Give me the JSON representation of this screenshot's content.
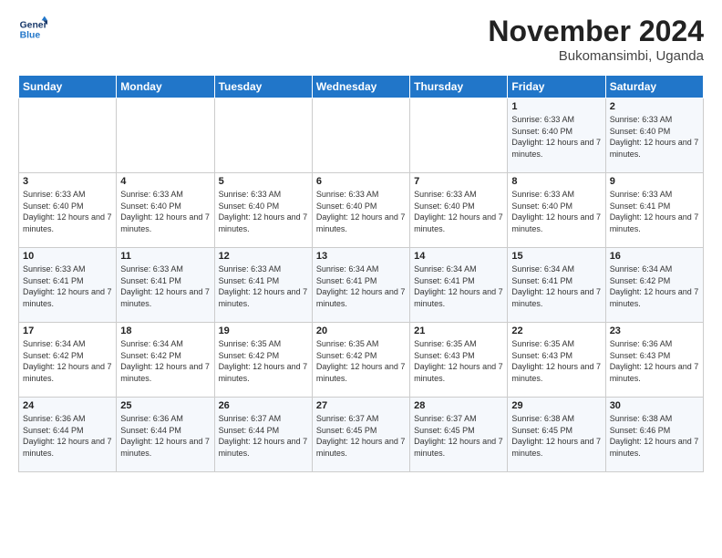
{
  "logo": {
    "line1": "General",
    "line2": "Blue"
  },
  "title": "November 2024",
  "location": "Bukomansimbi, Uganda",
  "days_of_week": [
    "Sunday",
    "Monday",
    "Tuesday",
    "Wednesday",
    "Thursday",
    "Friday",
    "Saturday"
  ],
  "weeks": [
    [
      {
        "day": "",
        "empty": true
      },
      {
        "day": "",
        "empty": true
      },
      {
        "day": "",
        "empty": true
      },
      {
        "day": "",
        "empty": true
      },
      {
        "day": "",
        "empty": true
      },
      {
        "day": "1",
        "sunrise": "6:33 AM",
        "sunset": "6:40 PM",
        "daylight": "12 hours and 7 minutes."
      },
      {
        "day": "2",
        "sunrise": "6:33 AM",
        "sunset": "6:40 PM",
        "daylight": "12 hours and 7 minutes."
      }
    ],
    [
      {
        "day": "3",
        "sunrise": "6:33 AM",
        "sunset": "6:40 PM",
        "daylight": "12 hours and 7 minutes."
      },
      {
        "day": "4",
        "sunrise": "6:33 AM",
        "sunset": "6:40 PM",
        "daylight": "12 hours and 7 minutes."
      },
      {
        "day": "5",
        "sunrise": "6:33 AM",
        "sunset": "6:40 PM",
        "daylight": "12 hours and 7 minutes."
      },
      {
        "day": "6",
        "sunrise": "6:33 AM",
        "sunset": "6:40 PM",
        "daylight": "12 hours and 7 minutes."
      },
      {
        "day": "7",
        "sunrise": "6:33 AM",
        "sunset": "6:40 PM",
        "daylight": "12 hours and 7 minutes."
      },
      {
        "day": "8",
        "sunrise": "6:33 AM",
        "sunset": "6:40 PM",
        "daylight": "12 hours and 7 minutes."
      },
      {
        "day": "9",
        "sunrise": "6:33 AM",
        "sunset": "6:41 PM",
        "daylight": "12 hours and 7 minutes."
      }
    ],
    [
      {
        "day": "10",
        "sunrise": "6:33 AM",
        "sunset": "6:41 PM",
        "daylight": "12 hours and 7 minutes."
      },
      {
        "day": "11",
        "sunrise": "6:33 AM",
        "sunset": "6:41 PM",
        "daylight": "12 hours and 7 minutes."
      },
      {
        "day": "12",
        "sunrise": "6:33 AM",
        "sunset": "6:41 PM",
        "daylight": "12 hours and 7 minutes."
      },
      {
        "day": "13",
        "sunrise": "6:34 AM",
        "sunset": "6:41 PM",
        "daylight": "12 hours and 7 minutes."
      },
      {
        "day": "14",
        "sunrise": "6:34 AM",
        "sunset": "6:41 PM",
        "daylight": "12 hours and 7 minutes."
      },
      {
        "day": "15",
        "sunrise": "6:34 AM",
        "sunset": "6:41 PM",
        "daylight": "12 hours and 7 minutes."
      },
      {
        "day": "16",
        "sunrise": "6:34 AM",
        "sunset": "6:42 PM",
        "daylight": "12 hours and 7 minutes."
      }
    ],
    [
      {
        "day": "17",
        "sunrise": "6:34 AM",
        "sunset": "6:42 PM",
        "daylight": "12 hours and 7 minutes."
      },
      {
        "day": "18",
        "sunrise": "6:34 AM",
        "sunset": "6:42 PM",
        "daylight": "12 hours and 7 minutes."
      },
      {
        "day": "19",
        "sunrise": "6:35 AM",
        "sunset": "6:42 PM",
        "daylight": "12 hours and 7 minutes."
      },
      {
        "day": "20",
        "sunrise": "6:35 AM",
        "sunset": "6:42 PM",
        "daylight": "12 hours and 7 minutes."
      },
      {
        "day": "21",
        "sunrise": "6:35 AM",
        "sunset": "6:43 PM",
        "daylight": "12 hours and 7 minutes."
      },
      {
        "day": "22",
        "sunrise": "6:35 AM",
        "sunset": "6:43 PM",
        "daylight": "12 hours and 7 minutes."
      },
      {
        "day": "23",
        "sunrise": "6:36 AM",
        "sunset": "6:43 PM",
        "daylight": "12 hours and 7 minutes."
      }
    ],
    [
      {
        "day": "24",
        "sunrise": "6:36 AM",
        "sunset": "6:44 PM",
        "daylight": "12 hours and 7 minutes."
      },
      {
        "day": "25",
        "sunrise": "6:36 AM",
        "sunset": "6:44 PM",
        "daylight": "12 hours and 7 minutes."
      },
      {
        "day": "26",
        "sunrise": "6:37 AM",
        "sunset": "6:44 PM",
        "daylight": "12 hours and 7 minutes."
      },
      {
        "day": "27",
        "sunrise": "6:37 AM",
        "sunset": "6:45 PM",
        "daylight": "12 hours and 7 minutes."
      },
      {
        "day": "28",
        "sunrise": "6:37 AM",
        "sunset": "6:45 PM",
        "daylight": "12 hours and 7 minutes."
      },
      {
        "day": "29",
        "sunrise": "6:38 AM",
        "sunset": "6:45 PM",
        "daylight": "12 hours and 7 minutes."
      },
      {
        "day": "30",
        "sunrise": "6:38 AM",
        "sunset": "6:46 PM",
        "daylight": "12 hours and 7 minutes."
      }
    ]
  ]
}
